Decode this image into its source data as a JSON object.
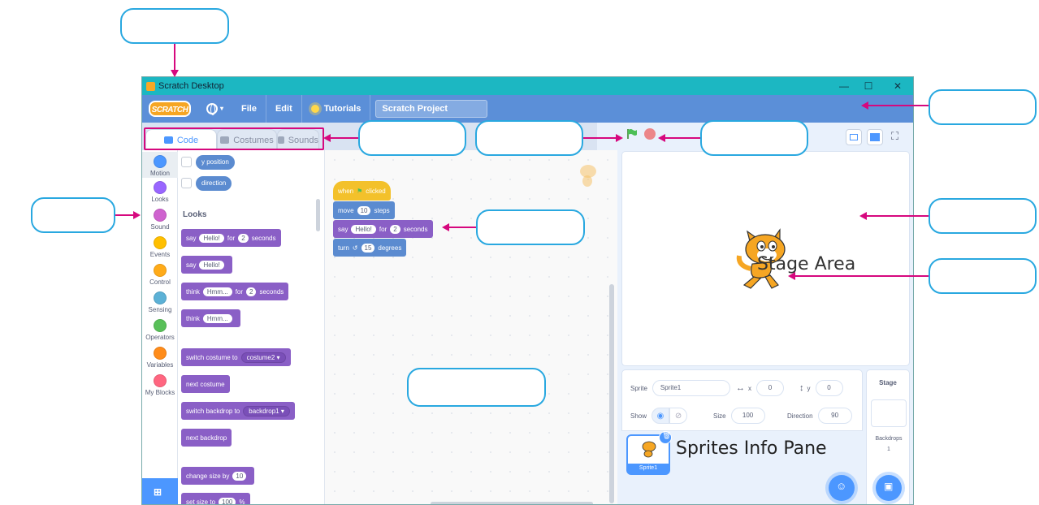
{
  "window": {
    "title": "Scratch Desktop",
    "minimize": "—",
    "maximize": "☐",
    "close": "✕"
  },
  "menubar": {
    "logo_text": "SCRATCH",
    "language_icon": "globe-icon",
    "file": "File",
    "edit": "Edit",
    "tutorials": "Tutorials",
    "project_title": "Scratch Project"
  },
  "tabs": {
    "code": "Code",
    "costumes": "Costumes",
    "sounds": "Sounds"
  },
  "categories": [
    {
      "label": "Motion",
      "color": "#4c97ff"
    },
    {
      "label": "Looks",
      "color": "#9966ff"
    },
    {
      "label": "Sound",
      "color": "#cf63cf"
    },
    {
      "label": "Events",
      "color": "#ffbf00"
    },
    {
      "label": "Control",
      "color": "#ffab19"
    },
    {
      "label": "Sensing",
      "color": "#5cb1d6"
    },
    {
      "label": "Operators",
      "color": "#59c059"
    },
    {
      "label": "Variables",
      "color": "#ff8c1a"
    },
    {
      "label": "My Blocks",
      "color": "#ff6680"
    }
  ],
  "palette": {
    "y_position": "y position",
    "direction": "direction",
    "section_title": "Looks",
    "say_for": {
      "say": "say",
      "text": "Hello!",
      "for": "for",
      "secs": "2",
      "seconds": "seconds"
    },
    "say": {
      "say": "say",
      "text": "Hello!"
    },
    "think_for": {
      "think": "think",
      "text": "Hmm...",
      "for": "for",
      "secs": "2",
      "seconds": "seconds"
    },
    "think": {
      "think": "think",
      "text": "Hmm..."
    },
    "switch_costume": {
      "label": "switch costume to",
      "value": "costume2"
    },
    "next_costume": "next costume",
    "switch_backdrop": {
      "label": "switch backdrop to",
      "value": "backdrop1"
    },
    "next_backdrop": "next backdrop",
    "change_size": {
      "label": "change size by",
      "value": "10"
    },
    "set_size": {
      "label": "set size to",
      "value": "100",
      "unit": "%"
    }
  },
  "script": {
    "when": "when",
    "clicked": "clicked",
    "move": "move",
    "steps_value": "10",
    "steps": "steps",
    "say": "say",
    "say_text": "Hello!",
    "for": "for",
    "secs": "2",
    "seconds": "seconds",
    "turn": "turn",
    "degrees_value": "15",
    "degrees": "degrees"
  },
  "zoom": {
    "in": "+",
    "out": "−",
    "reset": "="
  },
  "stage_label": "Stage Area",
  "sprite_info": {
    "sprite_label": "Sprite",
    "sprite_name": "Sprite1",
    "x_label": "x",
    "x_value": "0",
    "y_label": "y",
    "y_value": "0",
    "show_label": "Show",
    "size_label": "Size",
    "size_value": "100",
    "direction_label": "Direction",
    "direction_value": "90"
  },
  "sprite_list": {
    "thumb_name": "Sprite1",
    "pane_label": "Sprites Info Pane"
  },
  "stage_pane": {
    "title": "Stage",
    "backdrops_label": "Backdrops",
    "backdrops_count": "1"
  }
}
